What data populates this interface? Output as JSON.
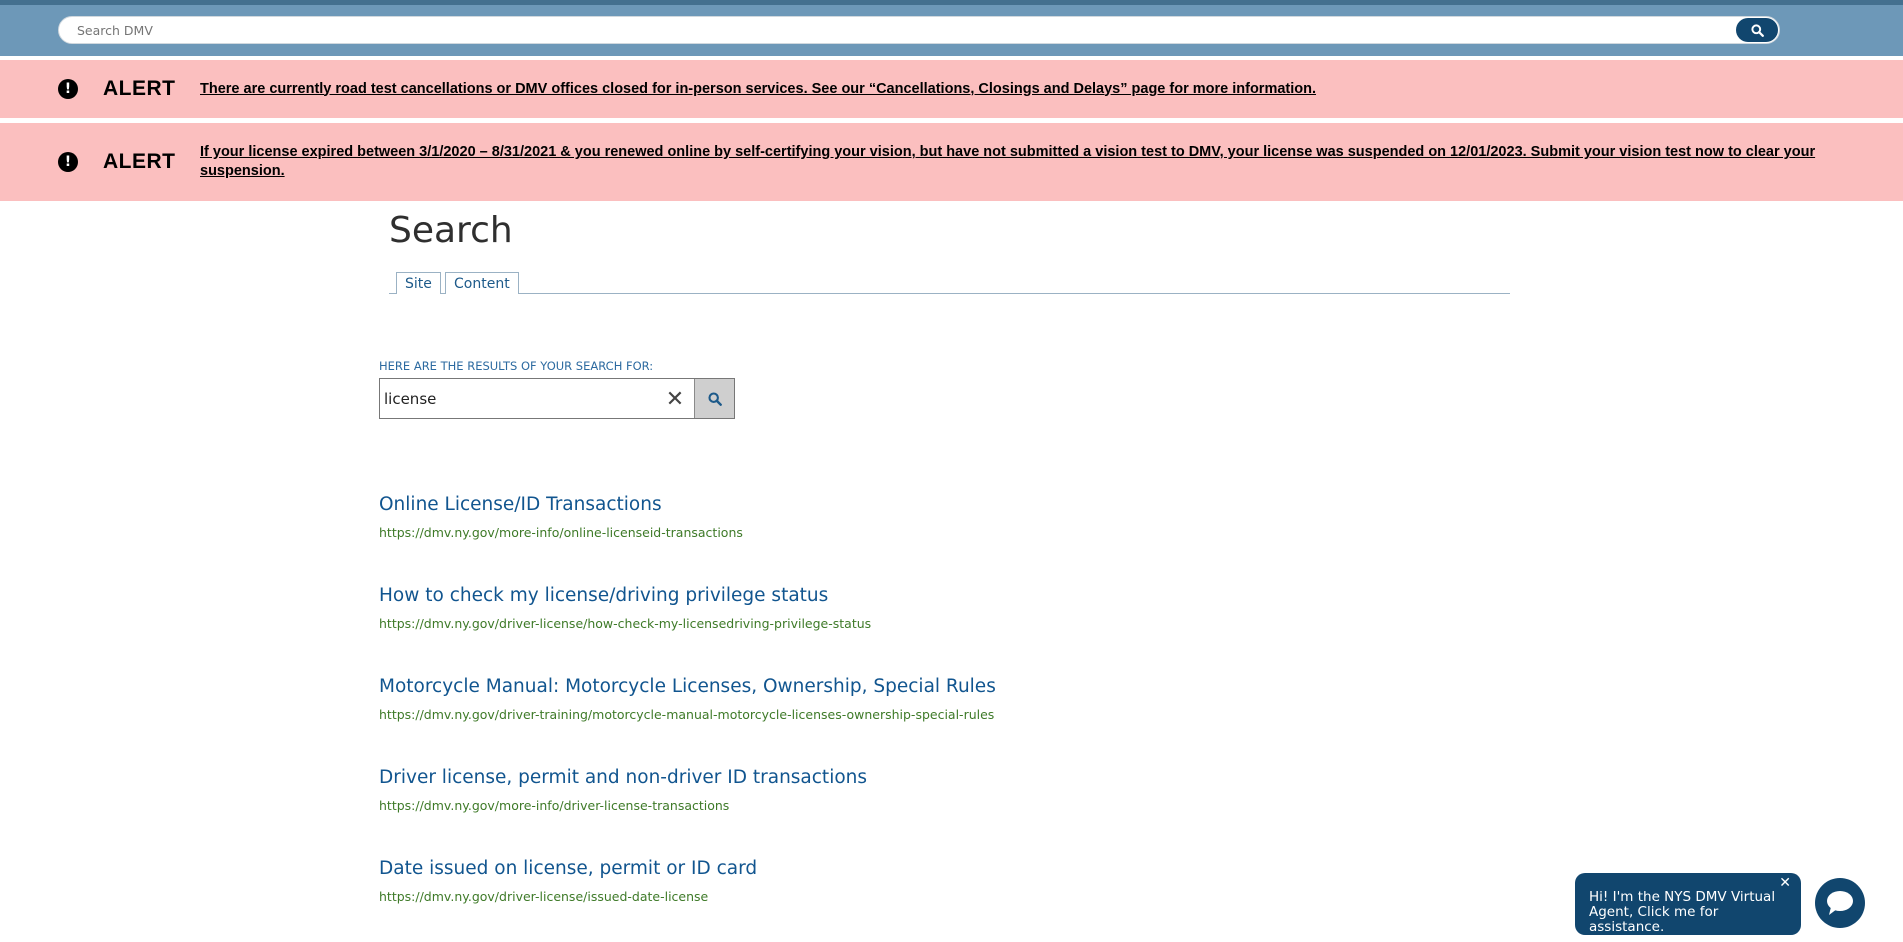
{
  "header": {
    "search_placeholder": "Search DMV",
    "search_icon": "search-icon"
  },
  "alerts": [
    {
      "icon": "exclamation-icon",
      "title": "ALERT",
      "text": "There are currently road test cancellations or DMV offices closed for in-person services. See our “Cancellations, Closings and Delays” page for more information."
    },
    {
      "icon": "exclamation-icon",
      "title": "ALERT",
      "text": "If your license expired between 3/1/2020 – 8/31/2021 & you renewed online by self-certifying your vision, but have not submitted a vision test to DMV, your license was suspended on 12/01/2023. Submit your vision test now to clear your suspension."
    }
  ],
  "page": {
    "title": "Search",
    "tabs": [
      {
        "label": "Site"
      },
      {
        "label": "Content"
      }
    ]
  },
  "results_search": {
    "label": "HERE ARE THE RESULTS OF YOUR SEARCH FOR:",
    "value": "license",
    "clear_symbol": "✕"
  },
  "results": [
    {
      "title": "Online License/ID Transactions",
      "url": "https://dmv.ny.gov/more-info/online-licenseid-transactions"
    },
    {
      "title": "How to check my license/driving privilege status",
      "url": "https://dmv.ny.gov/driver-license/how-check-my-licensedriving-privilege-status"
    },
    {
      "title": "Motorcycle Manual: Motorcycle Licenses, Ownership, Special Rules",
      "url": "https://dmv.ny.gov/driver-training/motorcycle-manual-motorcycle-licenses-ownership-special-rules"
    },
    {
      "title": "Driver license, permit and non-driver ID transactions",
      "url": "https://dmv.ny.gov/more-info/driver-license-transactions"
    },
    {
      "title": "Date issued on license, permit or ID card",
      "url": "https://dmv.ny.gov/driver-license/issued-date-license"
    }
  ],
  "chat": {
    "message": "Hi! I'm the NYS DMV Virtual Agent, Click me for assistance.",
    "close_symbol": "✕",
    "launcher_icon": "chat-bubble-icon"
  },
  "colors": {
    "header_bg": "#6d98b8",
    "alert_bg": "#fbbfbf",
    "link_blue": "#11558f",
    "url_green": "#3e7a28",
    "brand_navy": "#11466e"
  }
}
